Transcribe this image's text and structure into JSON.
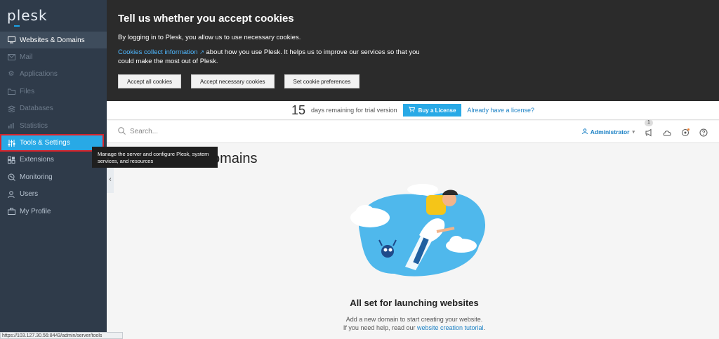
{
  "app": {
    "logo_text": "plesk"
  },
  "sidebar": {
    "items": [
      {
        "label": "Websites & Domains",
        "icon": "monitor-icon"
      },
      {
        "label": "Mail",
        "icon": "mail-icon"
      },
      {
        "label": "Applications",
        "icon": "gear-icon"
      },
      {
        "label": "Files",
        "icon": "folder-icon"
      },
      {
        "label": "Databases",
        "icon": "database-icon"
      },
      {
        "label": "Statistics",
        "icon": "bar-chart-icon"
      },
      {
        "label": "Tools & Settings",
        "icon": "sliders-icon"
      },
      {
        "label": "Extensions",
        "icon": "puzzle-icon"
      },
      {
        "label": "Monitoring",
        "icon": "search-monitor-icon"
      },
      {
        "label": "Users",
        "icon": "user-icon"
      },
      {
        "label": "My Profile",
        "icon": "briefcase-icon"
      }
    ],
    "collapse_glyph": "‹"
  },
  "tooltip": {
    "text": "Manage the server and configure Plesk, system services, and resources"
  },
  "cookie": {
    "title": "Tell us whether you accept cookies",
    "line1": "By logging in to Plesk, you allow us to use necessary cookies.",
    "link": "Cookies collect information",
    "line2": "about how you use Plesk. It helps us to improve our services so that you could make the most out of Plesk.",
    "buttons": [
      "Accept all cookies",
      "Accept necessary cookies",
      "Set cookie preferences"
    ]
  },
  "trial": {
    "days": "15",
    "text": "days remaining for trial version",
    "buy_label": "Buy a License",
    "license_link": "Already have a license?"
  },
  "header": {
    "search_placeholder": "Search...",
    "admin_label": "Administrator",
    "notification_count": "1"
  },
  "main": {
    "title_partial": "omains",
    "heading": "All set for launching websites",
    "sub_line1": "Add a new domain to start creating your website.",
    "sub_line2_prefix": "If you need help, read our",
    "sub_link": "website creation tutorial",
    "sub_line2_suffix": "."
  },
  "statusbar": {
    "url": "https://103.127.30.56:8443/admin/server/tools"
  },
  "colors": {
    "accent": "#28a9e6",
    "sidebar_bg": "#2f3b4a",
    "highlight_border": "#d8232a"
  }
}
